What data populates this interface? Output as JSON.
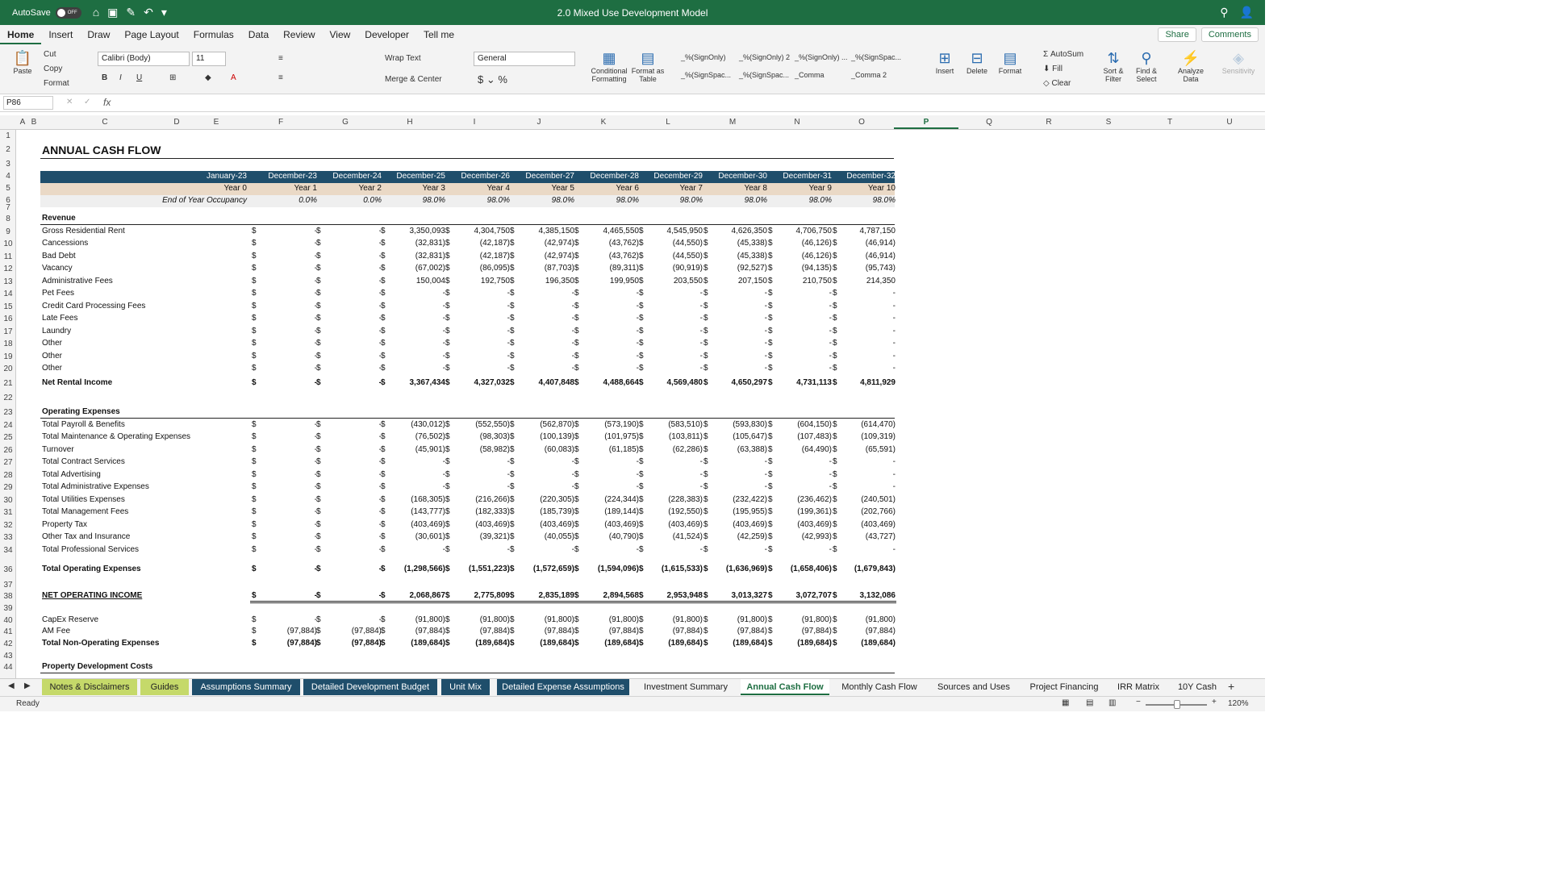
{
  "app": {
    "autosave_label": "AutoSave",
    "toggle": "OFF",
    "title": "2.0 Mixed Use Development Model"
  },
  "tabs": [
    "Home",
    "Insert",
    "Draw",
    "Page Layout",
    "Formulas",
    "Data",
    "Review",
    "View",
    "Developer",
    "Tell me"
  ],
  "share": "Share",
  "comments": "Comments",
  "ribbon": {
    "paste": "Paste",
    "cut": "Cut",
    "copy": "Copy",
    "format_painter": "Format",
    "font": "Calibri (Body)",
    "size": "11",
    "wrap": "Wrap Text",
    "merge": "Merge & Center",
    "number_format": "General",
    "cond": "Conditional Formatting",
    "fat": "Format as Table",
    "styles": [
      "_%(SignOnly)",
      "_%(SignOnly) 2",
      "_%(SignOnly) ...",
      "_%(SignSpac...",
      "_%(SignSpac...",
      "_%(SignSpac...",
      "_Comma",
      "_Comma 2"
    ],
    "insert": "Insert",
    "delete": "Delete",
    "format": "Format",
    "autosum": "AutoSum",
    "fill": "Fill",
    "clear": "Clear",
    "sort": "Sort & Filter",
    "find": "Find & Select",
    "analyze": "Analyze Data",
    "sensitivity": "Sensitivity"
  },
  "namebox": "P86",
  "fx": "fx",
  "columns": [
    "A",
    "B",
    "C",
    "D",
    "E",
    "F",
    "G",
    "H",
    "I",
    "J",
    "K",
    "L",
    "M",
    "N",
    "O",
    "P",
    "Q",
    "R",
    "S",
    "T",
    "U"
  ],
  "sheet": {
    "title": "ANNUAL CASH FLOW",
    "dates": [
      "January-23",
      "December-23",
      "December-24",
      "December-25",
      "December-26",
      "December-27",
      "December-28",
      "December-29",
      "December-30",
      "December-31",
      "December-32"
    ],
    "years": [
      "Year 0",
      "Year 1",
      "Year 2",
      "Year 3",
      "Year 4",
      "Year 5",
      "Year 6",
      "Year 7",
      "Year 8",
      "Year 9",
      "Year 10"
    ],
    "occupancy_label": "End of Year Occupancy",
    "occupancy": [
      "0.0%",
      "0.0%",
      "98.0%",
      "98.0%",
      "98.0%",
      "98.0%",
      "98.0%",
      "98.0%",
      "98.0%",
      "98.0%"
    ],
    "rows": [
      {
        "r": "8",
        "label": "Revenue",
        "header": true
      },
      {
        "r": "9",
        "label": "Gross Residential Rent",
        "v": [
          "-",
          "-",
          "3,350,093",
          "4,304,750",
          "4,385,150",
          "4,465,550",
          "4,545,950",
          "4,626,350",
          "4,706,750",
          "4,787,150"
        ]
      },
      {
        "r": "10",
        "label": "Cancessions",
        "v": [
          "-",
          "-",
          "(32,831)",
          "(42,187)",
          "(42,974)",
          "(43,762)",
          "(44,550)",
          "(45,338)",
          "(46,126)",
          "(46,914)"
        ]
      },
      {
        "r": "11",
        "label": "Bad Debt",
        "v": [
          "-",
          "-",
          "(32,831)",
          "(42,187)",
          "(42,974)",
          "(43,762)",
          "(44,550)",
          "(45,338)",
          "(46,126)",
          "(46,914)"
        ]
      },
      {
        "r": "12",
        "label": "Vacancy",
        "v": [
          "-",
          "-",
          "(67,002)",
          "(86,095)",
          "(87,703)",
          "(89,311)",
          "(90,919)",
          "(92,527)",
          "(94,135)",
          "(95,743)"
        ]
      },
      {
        "r": "13",
        "label": "Administrative Fees",
        "v": [
          "-",
          "-",
          "150,004",
          "192,750",
          "196,350",
          "199,950",
          "203,550",
          "207,150",
          "210,750",
          "214,350"
        ]
      },
      {
        "r": "14",
        "label": "Pet Fees",
        "v": [
          "-",
          "-",
          "-",
          "-",
          "-",
          "-",
          "-",
          "-",
          "-",
          "-"
        ]
      },
      {
        "r": "15",
        "label": "Credit Card Processing Fees",
        "v": [
          "-",
          "-",
          "-",
          "-",
          "-",
          "-",
          "-",
          "-",
          "-",
          "-"
        ]
      },
      {
        "r": "16",
        "label": "Late Fees",
        "v": [
          "-",
          "-",
          "-",
          "-",
          "-",
          "-",
          "-",
          "-",
          "-",
          "-"
        ]
      },
      {
        "r": "17",
        "label": "Laundry",
        "v": [
          "-",
          "-",
          "-",
          "-",
          "-",
          "-",
          "-",
          "-",
          "-",
          "-"
        ]
      },
      {
        "r": "18",
        "label": "Other",
        "v": [
          "-",
          "-",
          "-",
          "-",
          "-",
          "-",
          "-",
          "-",
          "-",
          "-"
        ]
      },
      {
        "r": "19",
        "label": "Other",
        "v": [
          "-",
          "-",
          "-",
          "-",
          "-",
          "-",
          "-",
          "-",
          "-",
          "-"
        ]
      },
      {
        "r": "20",
        "label": "Other",
        "v": [
          "-",
          "-",
          "-",
          "-",
          "-",
          "-",
          "-",
          "-",
          "-",
          "-"
        ]
      },
      {
        "r": "21",
        "label": "Net Rental Income",
        "bold": true,
        "v": [
          "-",
          "-",
          "3,367,434",
          "4,327,032",
          "4,407,848",
          "4,488,664",
          "4,569,480",
          "4,650,297",
          "4,731,113",
          "4,811,929"
        ]
      },
      {
        "r": "22",
        "label": ""
      },
      {
        "r": "23",
        "label": "Operating Expenses",
        "header": true
      },
      {
        "r": "24",
        "label": "Total Payroll & Benefits",
        "v": [
          "-",
          "-",
          "(430,012)",
          "(552,550)",
          "(562,870)",
          "(573,190)",
          "(583,510)",
          "(593,830)",
          "(604,150)",
          "(614,470)"
        ]
      },
      {
        "r": "25",
        "label": "Total Maintenance & Operating Expenses",
        "v": [
          "-",
          "-",
          "(76,502)",
          "(98,303)",
          "(100,139)",
          "(101,975)",
          "(103,811)",
          "(105,647)",
          "(107,483)",
          "(109,319)"
        ]
      },
      {
        "r": "26",
        "label": "Turnover",
        "v": [
          "-",
          "-",
          "(45,901)",
          "(58,982)",
          "(60,083)",
          "(61,185)",
          "(62,286)",
          "(63,388)",
          "(64,490)",
          "(65,591)"
        ]
      },
      {
        "r": "27",
        "label": "Total Contract Services",
        "v": [
          "-",
          "-",
          "-",
          "-",
          "-",
          "-",
          "-",
          "-",
          "-",
          "-"
        ]
      },
      {
        "r": "28",
        "label": "Total Advertising",
        "v": [
          "-",
          "-",
          "-",
          "-",
          "-",
          "-",
          "-",
          "-",
          "-",
          "-"
        ]
      },
      {
        "r": "29",
        "label": "Total Administrative Expenses",
        "v": [
          "-",
          "-",
          "-",
          "-",
          "-",
          "-",
          "-",
          "-",
          "-",
          "-"
        ]
      },
      {
        "r": "30",
        "label": "Total Utilities Expenses",
        "v": [
          "-",
          "-",
          "(168,305)",
          "(216,266)",
          "(220,305)",
          "(224,344)",
          "(228,383)",
          "(232,422)",
          "(236,462)",
          "(240,501)"
        ]
      },
      {
        "r": "31",
        "label": "Total Management Fees",
        "v": [
          "-",
          "-",
          "(143,777)",
          "(182,333)",
          "(185,739)",
          "(189,144)",
          "(192,550)",
          "(195,955)",
          "(199,361)",
          "(202,766)"
        ]
      },
      {
        "r": "32",
        "label": "Property Tax",
        "v": [
          "-",
          "-",
          "(403,469)",
          "(403,469)",
          "(403,469)",
          "(403,469)",
          "(403,469)",
          "(403,469)",
          "(403,469)",
          "(403,469)"
        ]
      },
      {
        "r": "33",
        "label": "Other Tax and Insurance",
        "v": [
          "-",
          "-",
          "(30,601)",
          "(39,321)",
          "(40,055)",
          "(40,790)",
          "(41,524)",
          "(42,259)",
          "(42,993)",
          "(43,727)"
        ]
      },
      {
        "r": "34",
        "label": "Total Professional Services",
        "v": [
          "-",
          "-",
          "-",
          "-",
          "-",
          "-",
          "-",
          "-",
          "-",
          "-"
        ]
      },
      {
        "r": "36",
        "label": "Total Operating Expenses",
        "bold": true,
        "v": [
          "-",
          "-",
          "(1,298,566)",
          "(1,551,223)",
          "(1,572,659)",
          "(1,594,096)",
          "(1,615,533)",
          "(1,636,969)",
          "(1,658,406)",
          "(1,679,843)"
        ]
      },
      {
        "r": "37",
        "label": ""
      },
      {
        "r": "38",
        "label": "NET OPERATING INCOME",
        "bold": true,
        "noi": true,
        "v": [
          "-",
          "-",
          "2,068,867",
          "2,775,809",
          "2,835,189",
          "2,894,568",
          "2,953,948",
          "3,013,327",
          "3,072,707",
          "3,132,086"
        ]
      },
      {
        "r": "39",
        "label": ""
      },
      {
        "r": "40",
        "label": "CapEx Reserve",
        "v": [
          "-",
          "-",
          "(91,800)",
          "(91,800)",
          "(91,800)",
          "(91,800)",
          "(91,800)",
          "(91,800)",
          "(91,800)",
          "(91,800)"
        ]
      },
      {
        "r": "41",
        "label": "AM Fee",
        "v": [
          "(97,884)",
          "(97,884)",
          "(97,884)",
          "(97,884)",
          "(97,884)",
          "(97,884)",
          "(97,884)",
          "(97,884)",
          "(97,884)",
          "(97,884)"
        ]
      },
      {
        "r": "42",
        "label": "Total Non-Operating Expenses",
        "bold": true,
        "v": [
          "(97,884)",
          "(97,884)",
          "(189,684)",
          "(189,684)",
          "(189,684)",
          "(189,684)",
          "(189,684)",
          "(189,684)",
          "(189,684)",
          "(189,684)"
        ]
      },
      {
        "r": "43",
        "label": ""
      },
      {
        "r": "44",
        "label": "Property Development  Costs",
        "header": true
      }
    ]
  },
  "sheet_tabs": [
    "Notes & Disclaimers",
    "Guides",
    "Assumptions Summary",
    "Detailed Development Budget",
    "Unit Mix",
    "Detailed Expense Assumptions",
    "Investment Summary",
    "Annual Cash Flow",
    "Monthly Cash Flow",
    "Sources and Uses",
    "Project Financing",
    "IRR Matrix",
    "10Y Cash"
  ],
  "status": "Ready",
  "zoom": "120%"
}
